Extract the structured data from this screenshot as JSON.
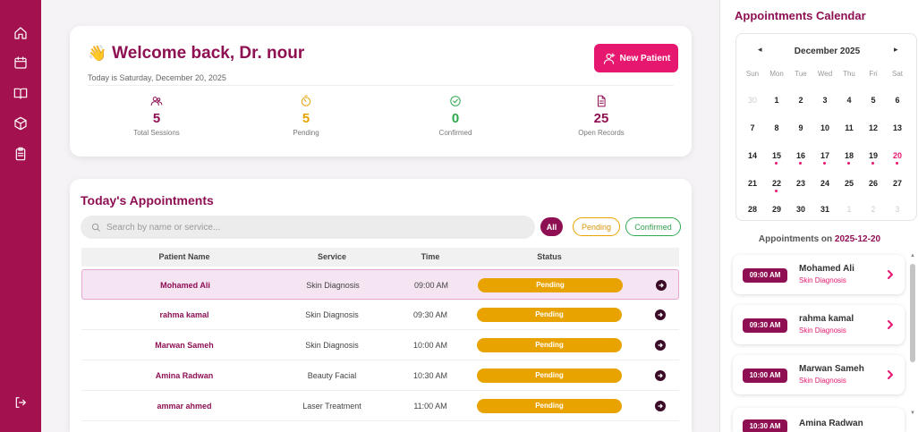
{
  "sidebar": {
    "icons": [
      "home-icon",
      "calendar-icon",
      "book-icon",
      "cube-icon",
      "clipboard-icon"
    ],
    "logout_icon": "logout-icon"
  },
  "welcome": {
    "wave_icon": "👋",
    "title": "Welcome back, Dr. nour",
    "subtitle": "Today is Saturday, December 20, 2025",
    "new_patient_label": "New Patient"
  },
  "stats": [
    {
      "value": "5",
      "label": "Total Sessions",
      "color": "#8e1053",
      "icon": "users-icon"
    },
    {
      "value": "5",
      "label": "Pending",
      "color": "#e8a300",
      "icon": "timer-icon"
    },
    {
      "value": "0",
      "label": "Confirmed",
      "color": "#2fa84f",
      "icon": "check-circle-icon"
    },
    {
      "value": "25",
      "label": "Open Records",
      "color": "#8e1053",
      "icon": "file-icon"
    }
  ],
  "appointments": {
    "title": "Today's Appointments",
    "search_placeholder": "Search by name or service...",
    "filters": {
      "all": "All",
      "pending": "Pending",
      "confirmed": "Confirmed"
    },
    "columns": {
      "patient": "Patient Name",
      "service": "Service",
      "time": "Time",
      "status": "Status"
    },
    "rows": [
      {
        "patient": "Mohamed Ali",
        "service": "Skin Diagnosis",
        "time": "09:00 AM",
        "status": "Pending"
      },
      {
        "patient": "rahma kamal",
        "service": "Skin Diagnosis",
        "time": "09:30 AM",
        "status": "Pending"
      },
      {
        "patient": "Marwan Sameh",
        "service": "Skin Diagnosis",
        "time": "10:00 AM",
        "status": "Pending"
      },
      {
        "patient": "Amina Radwan",
        "service": "Beauty Facial",
        "time": "10:30 AM",
        "status": "Pending"
      },
      {
        "patient": "ammar ahmed",
        "service": "Laser Treatment",
        "time": "11:00 AM",
        "status": "Pending"
      }
    ]
  },
  "calendar": {
    "title": "Appointments Calendar",
    "month": "December 2025",
    "prev": "◂",
    "next": "▸",
    "weekdays": [
      "Sun",
      "Mon",
      "Tue",
      "Wed",
      "Thu",
      "Fri",
      "Sat"
    ],
    "days": [
      "30",
      "1",
      "2",
      "3",
      "4",
      "5",
      "6",
      "7",
      "8",
      "9",
      "10",
      "11",
      "12",
      "13",
      "14",
      "15",
      "16",
      "17",
      "18",
      "19",
      "20",
      "21",
      "22",
      "23",
      "24",
      "25",
      "26",
      "27",
      "28",
      "29",
      "30",
      "31",
      "1",
      "2",
      "3"
    ],
    "other_month_indices": [
      0,
      32,
      33,
      34
    ],
    "today_index": 20,
    "dot_indices": [
      15,
      16,
      17,
      18,
      19,
      20,
      22
    ]
  },
  "day_list": {
    "title_prefix": "Appointments on",
    "date": "2025-12-20",
    "items": [
      {
        "time": "09:00 AM",
        "name": "Mohamed Ali",
        "service": "Skin Diagnosis"
      },
      {
        "time": "09:30 AM",
        "name": "rahma kamal",
        "service": "Skin Diagnosis"
      },
      {
        "time": "10:00 AM",
        "name": "Marwan Sameh",
        "service": "Skin Diagnosis"
      },
      {
        "time": "10:30 AM",
        "name": "Amina Radwan",
        "service": ""
      }
    ],
    "scroll_up": "▲",
    "scroll_down": "▼"
  }
}
